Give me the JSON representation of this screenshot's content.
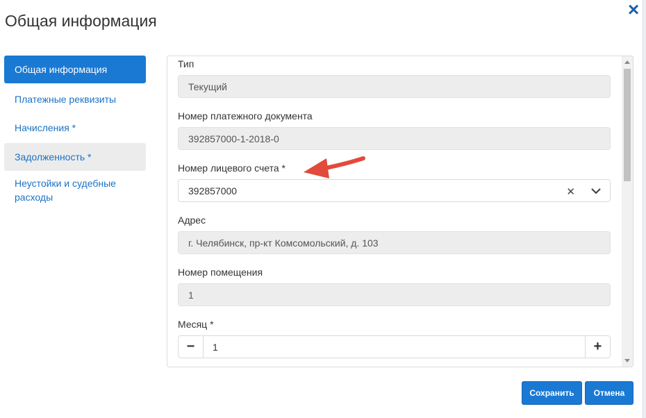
{
  "dialog": {
    "title": "Общая информация",
    "close_icon": "close-icon"
  },
  "sidebar": {
    "items": [
      {
        "label": "Общая информация",
        "state": "active"
      },
      {
        "label": "Платежные реквизиты",
        "state": "normal"
      },
      {
        "label": "Начисления *",
        "state": "normal"
      },
      {
        "label": "Задолженность *",
        "state": "hover"
      },
      {
        "label": "Неустойки и судебные расходы",
        "state": "normal"
      }
    ]
  },
  "form": {
    "type": {
      "label": "Тип",
      "value": "Текущий"
    },
    "doc_number": {
      "label": "Номер платежного документа",
      "value": "392857000-1-2018-0"
    },
    "account_number": {
      "label": "Номер лицевого счета *",
      "value": "392857000",
      "clear_icon": "clear-icon",
      "caret_icon": "chevron-down-icon"
    },
    "address": {
      "label": "Адрес",
      "value": "г. Челябинск, пр-кт Комсомольский, д. 103"
    },
    "room_number": {
      "label": "Номер помещения",
      "value": "1"
    },
    "month": {
      "label": "Месяц *",
      "value": "1",
      "minus": "−",
      "plus": "+"
    }
  },
  "footer": {
    "save_label": "Сохранить",
    "cancel_label": "Отмена"
  },
  "colors": {
    "accent": "#1a79d3",
    "arrow": "#e24a3b"
  }
}
